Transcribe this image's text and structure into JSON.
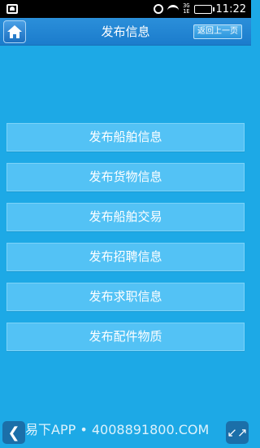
{
  "status_bar": {
    "time": "11:22",
    "signal_text": "3G\n1E"
  },
  "header": {
    "title": "发布信息",
    "back_label": "返回上一页",
    "home_icon": "home-icon"
  },
  "menu": {
    "items": [
      {
        "label": "发布船舶信息"
      },
      {
        "label": "发布货物信息"
      },
      {
        "label": "发布船舶交易"
      },
      {
        "label": "发布招聘信息"
      },
      {
        "label": "发布求职信息"
      },
      {
        "label": "发布配件物质"
      }
    ]
  },
  "overlay": {
    "watermark": "易下APP • 4008891800.COM",
    "left_icon": "chevron-left-icon",
    "right_icon": "collapse-arrows-icon"
  },
  "colors": {
    "background": "#1da9e6",
    "header": "#1b7ccc",
    "button": "#53c2f5"
  }
}
